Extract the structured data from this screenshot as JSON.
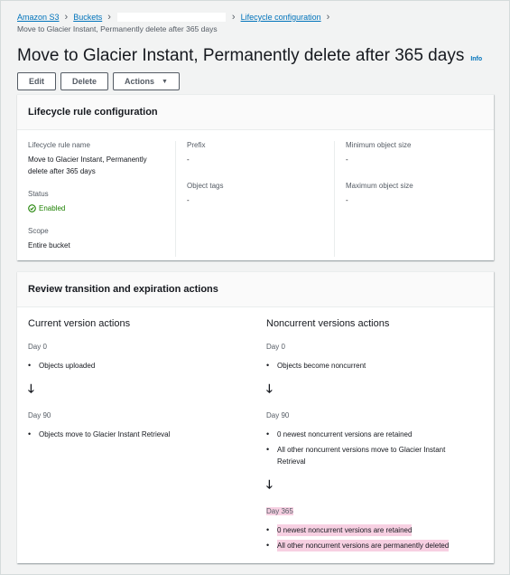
{
  "breadcrumb": {
    "amazon_s3": "Amazon S3",
    "buckets": "Buckets",
    "lifecycle": "Lifecycle configuration",
    "current": "Move to Glacier Instant, Permanently delete after 365 days"
  },
  "header": {
    "title": "Move to Glacier Instant, Permanently delete after 365 days",
    "info": "Info"
  },
  "toolbar": {
    "edit": "Edit",
    "delete": "Delete",
    "actions": "Actions"
  },
  "config": {
    "heading": "Lifecycle rule configuration",
    "rule_name_label": "Lifecycle rule name",
    "rule_name": "Move to Glacier Instant, Permanently delete after 365 days",
    "status_label": "Status",
    "status": "Enabled",
    "scope_label": "Scope",
    "scope": "Entire bucket",
    "prefix_label": "Prefix",
    "prefix": "-",
    "tags_label": "Object tags",
    "tags": "-",
    "min_size_label": "Minimum object size",
    "min_size": "-",
    "max_size_label": "Maximum object size",
    "max_size": "-"
  },
  "review": {
    "heading": "Review transition and expiration actions",
    "current": {
      "heading": "Current version actions",
      "day0": "Day 0",
      "day0_item": "Objects uploaded",
      "day90": "Day 90",
      "day90_item": "Objects move to Glacier Instant Retrieval"
    },
    "noncurrent": {
      "heading": "Noncurrent versions actions",
      "day0": "Day 0",
      "day0_item": "Objects become noncurrent",
      "day90": "Day 90",
      "day90_item1": "0 newest noncurrent versions are retained",
      "day90_item2": "All other noncurrent versions move to Glacier Instant Retrieval",
      "day365": "Day 365",
      "day365_item1": "0 newest noncurrent versions are retained",
      "day365_item2": "All other noncurrent versions are permanently deleted"
    },
    "arrow": "🡓"
  },
  "colors": {
    "link": "#0073bb",
    "success": "#1d8102",
    "highlight": "#f7d0e2"
  }
}
